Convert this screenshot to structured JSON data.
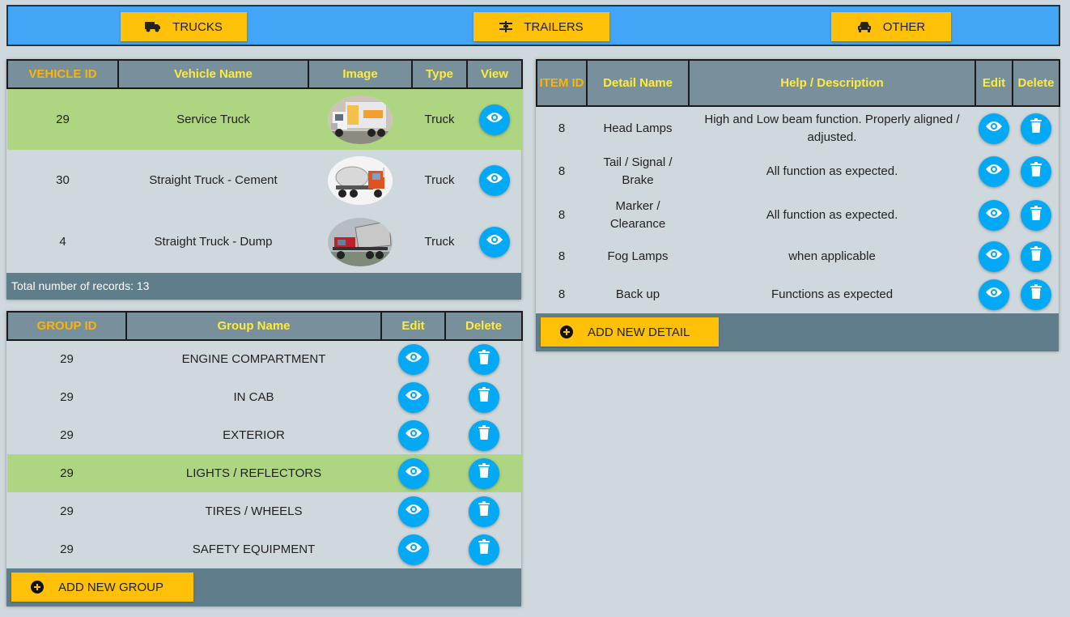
{
  "nav": {
    "trucks_label": "TRUCKS",
    "trailers_label": "TRAILERS",
    "other_label": "OTHER"
  },
  "vehicles": {
    "headers": {
      "id": "VEHICLE ID",
      "name": "Vehicle Name",
      "image": "Image",
      "type": "Type",
      "view": "View"
    },
    "rows": [
      {
        "id": "29",
        "name": "Service Truck",
        "type": "Truck",
        "selected": true
      },
      {
        "id": "30",
        "name": "Straight Truck - Cement",
        "type": "Truck",
        "selected": false
      },
      {
        "id": "4",
        "name": "Straight Truck - Dump",
        "type": "Truck",
        "selected": false
      }
    ],
    "total_text": "Total number of records: 13"
  },
  "groups": {
    "headers": {
      "id": "GROUP ID",
      "name": "Group Name",
      "edit": "Edit",
      "delete": "Delete"
    },
    "rows": [
      {
        "id": "29",
        "name": "ENGINE COMPARTMENT",
        "selected": false
      },
      {
        "id": "29",
        "name": "IN CAB",
        "selected": false
      },
      {
        "id": "29",
        "name": "EXTERIOR",
        "selected": false
      },
      {
        "id": "29",
        "name": "LIGHTS / REFLECTORS",
        "selected": true
      },
      {
        "id": "29",
        "name": "TIRES / WHEELS",
        "selected": false
      },
      {
        "id": "29",
        "name": "SAFETY EQUIPMENT",
        "selected": false
      }
    ],
    "add_label": "ADD NEW GROUP"
  },
  "details": {
    "headers": {
      "id": "ITEM ID",
      "name": "Detail Name",
      "help": "Help / Description",
      "edit": "Edit",
      "delete": "Delete"
    },
    "rows": [
      {
        "id": "8",
        "name": "Head Lamps",
        "help": "High and Low beam function. Properly aligned / adjusted."
      },
      {
        "id": "8",
        "name": "Tail / Signal / Brake",
        "help": "All function as expected."
      },
      {
        "id": "8",
        "name": "Marker / Clearance",
        "help": "All function as expected."
      },
      {
        "id": "8",
        "name": "Fog Lamps",
        "help": "when applicable"
      },
      {
        "id": "8",
        "name": "Back up",
        "help": "Functions as expected"
      }
    ],
    "add_label": "ADD NEW DETAIL"
  },
  "colors": {
    "accent": "#ffc107",
    "nav_bar": "#42a5f5",
    "header": "#78909c",
    "selected_row": "#aed581",
    "icon_button": "#03a9f4",
    "footer": "#607d8b"
  },
  "icons": {
    "trucks": "truck-icon",
    "trailers": "trailer-icon",
    "other": "car-icon",
    "view": "eye-icon",
    "delete": "trash-icon",
    "add": "plus-circle-icon"
  }
}
